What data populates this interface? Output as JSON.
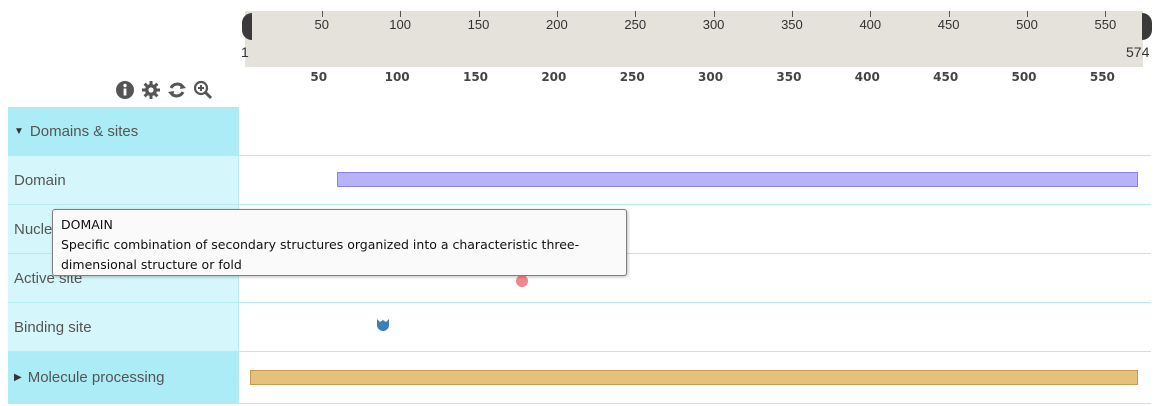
{
  "ruler": {
    "start_label": "1",
    "end_label": "574",
    "ticks": [
      "50",
      "100",
      "150",
      "200",
      "250",
      "300",
      "350",
      "400",
      "450",
      "500",
      "550"
    ]
  },
  "toolbar": {
    "icons": [
      "info-icon",
      "settings-gear-icon",
      "refresh-icon",
      "zoom-in-icon"
    ]
  },
  "tracks": {
    "domains_sites": {
      "label": "Domains & sites",
      "expanded": true
    },
    "domain": {
      "label": "Domain",
      "feature": {
        "start": 60,
        "end": 574
      }
    },
    "nucleotide": {
      "label": "Nucle"
    },
    "active_site": {
      "label": "Active site",
      "feature": {
        "position": 178
      }
    },
    "binding_site": {
      "label": "Binding site",
      "feature": {
        "position": 89
      }
    },
    "molecule_processing": {
      "label": "Molecule processing",
      "expanded": false,
      "feature": {
        "start": 1,
        "end": 574
      }
    }
  },
  "tooltip": {
    "title": "DOMAIN",
    "line1": "Specific combination of secondary structures organized into a characteristic three-",
    "line2": "dimensional structure or fold"
  },
  "colors": {
    "category_bg": "#acecf7",
    "row_label_bg": "#d5f6fb",
    "domain_fill": "#b8b3f8",
    "molecule_fill": "#e6c17e",
    "active_site": "#f2868b",
    "binding_site": "#3a7fb8"
  }
}
